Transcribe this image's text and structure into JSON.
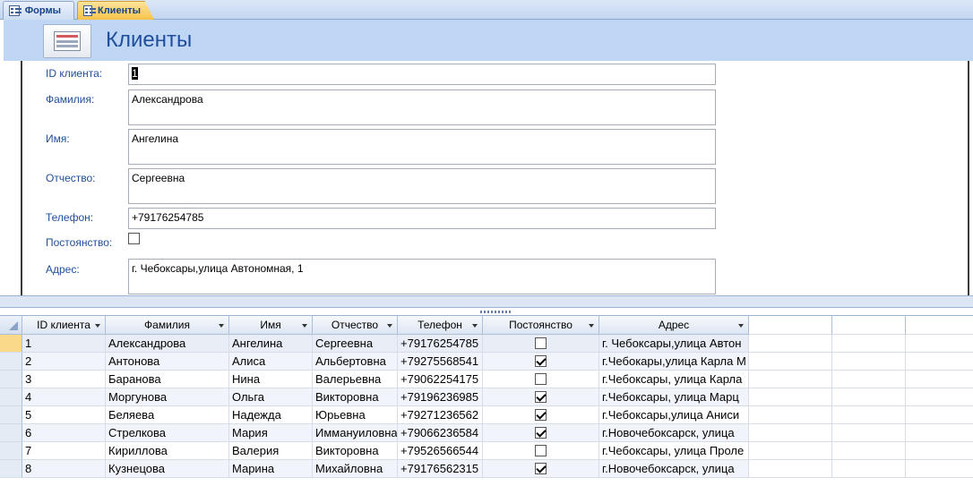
{
  "tabs": [
    {
      "label": "Формы",
      "active": false
    },
    {
      "label": "Клиенты",
      "active": true
    }
  ],
  "form": {
    "title": "Клиенты",
    "fields": {
      "id_label": "ID клиента:",
      "id_value": "1",
      "lastname_label": "Фамилия:",
      "lastname_value": "Александрова",
      "firstname_label": "Имя:",
      "firstname_value": "Ангелина",
      "patronymic_label": "Отчество:",
      "patronymic_value": "Сергеевна",
      "phone_label": "Телефон:",
      "phone_value": "+79176254785",
      "regular_label": "Постоянство:",
      "regular_checked": false,
      "address_label": "Адрес:",
      "address_value": "г. Чебоксары,улица Автономная, 1"
    }
  },
  "datasheet": {
    "columns": [
      "ID клиента",
      "Фамилия",
      "Имя",
      "Отчество",
      "Телефон",
      "Постоянство",
      "Адрес"
    ],
    "rows": [
      {
        "id": "1",
        "lastname": "Александрова",
        "firstname": "Ангелина",
        "patronymic": "Сергеевна",
        "phone": "+79176254785",
        "regular": false,
        "address": "г. Чебоксары,улица Автон"
      },
      {
        "id": "2",
        "lastname": "Антонова",
        "firstname": "Алиса",
        "patronymic": "Альбертовна",
        "phone": "+79275568541",
        "regular": true,
        "address": "г.Чебокары,улица Карла М"
      },
      {
        "id": "3",
        "lastname": "Баранова",
        "firstname": "Нина",
        "patronymic": " Валерьевна",
        "phone": "+79062254175",
        "regular": false,
        "address": "г.Чебоксары, улица Карла"
      },
      {
        "id": "4",
        "lastname": "Моргунова",
        "firstname": "Ольга",
        "patronymic": "Викторовна",
        "phone": "+79196236985",
        "regular": true,
        "address": "г.Чебоксары, улица Марц"
      },
      {
        "id": "5",
        "lastname": "Беляева",
        "firstname": "Надежда",
        "patronymic": " Юрьевна",
        "phone": "+79271236562",
        "regular": true,
        "address": "г.Чебоксары,улица Аниси"
      },
      {
        "id": "6",
        "lastname": "Стрелкова",
        "firstname": "Мария",
        "patronymic": "Иммануиловна",
        "phone": "+79066236584",
        "regular": true,
        "address": "г.Новочебоксарск, улица"
      },
      {
        "id": "7",
        "lastname": "Кириллова",
        "firstname": "Валерия",
        "patronymic": "Викторовна",
        "phone": "+79526566544",
        "regular": false,
        "address": "г.Чебоксары, улица Проле"
      },
      {
        "id": "8",
        "lastname": "Кузнецова",
        "firstname": "Марина",
        "patronymic": "Михайловна",
        "phone": "+79176562315",
        "regular": true,
        "address": "г.Новочебоксарск, улица"
      }
    ]
  }
}
